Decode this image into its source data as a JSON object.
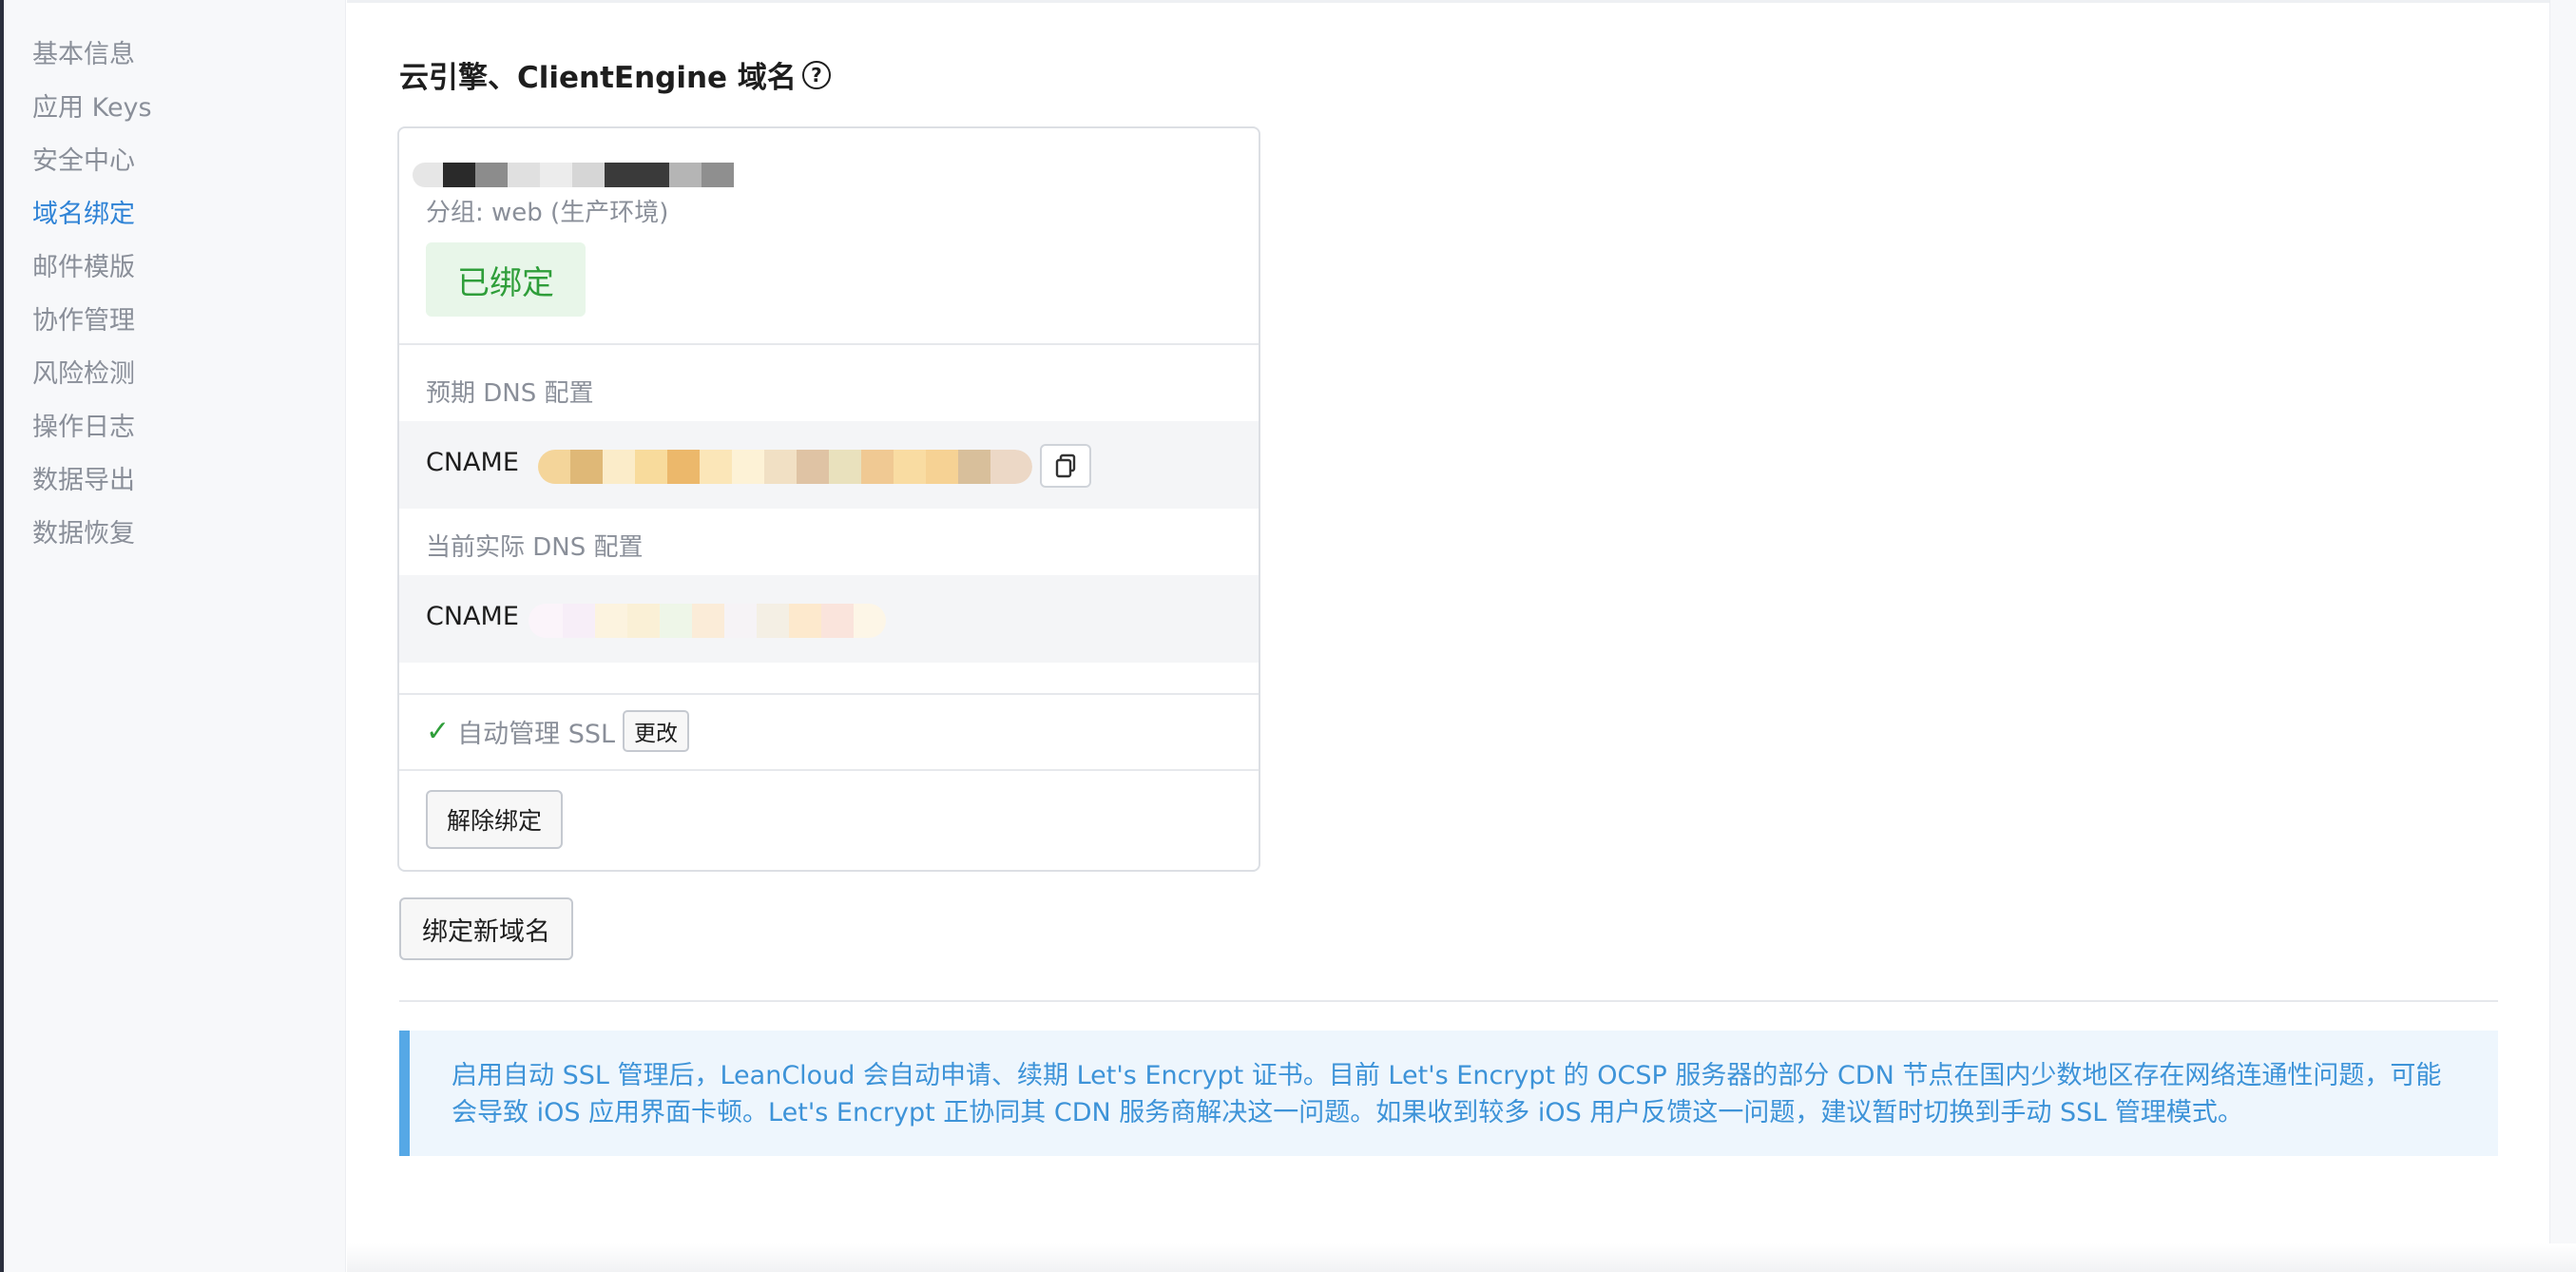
{
  "sidebar": {
    "items": [
      {
        "label": "基本信息"
      },
      {
        "label": "应用 Keys"
      },
      {
        "label": "安全中心"
      },
      {
        "label": "域名绑定"
      },
      {
        "label": "邮件模版"
      },
      {
        "label": "协作管理"
      },
      {
        "label": "风险检测"
      },
      {
        "label": "操作日志"
      },
      {
        "label": "数据导出"
      },
      {
        "label": "数据恢复"
      }
    ],
    "active_label": "域名绑定"
  },
  "section": {
    "title": "云引擎、ClientEngine 域名",
    "help_icon": "question-circle-icon"
  },
  "domain_card": {
    "group": "分组: web (生产环境)",
    "status": "已绑定",
    "expected_dns_label": "预期 DNS 配置",
    "expected_record_type": "CNAME",
    "copy_icon": "copy-icon",
    "actual_dns_label": "当前实际 DNS 配置",
    "actual_record_type": "CNAME",
    "ssl_check_icon": "check-icon",
    "ssl_label": "自动管理 SSL",
    "ssl_change_label": "更改",
    "unbind_label": "解除绑定"
  },
  "bind_new_label": "绑定新域名",
  "notice": {
    "text": "启用自动 SSL 管理后，LeanCloud 会自动申请、续期 Let's Encrypt 证书。目前 Let's Encrypt 的 OCSP 服务器的部分 CDN 节点在国内少数地区存在网络连通性问题，可能会导致 iOS 应用界面卡顿。Let's Encrypt 正协同其 CDN 服务商解决这一问题。如果收到较多 iOS 用户反馈这一问题，建议暂时切换到手动 SSL 管理模式。"
  },
  "colors": {
    "accent": "#2f83d6",
    "success": "#2f9e3a",
    "notice_text": "#3d93d8",
    "notice_border": "#56a8e6"
  }
}
